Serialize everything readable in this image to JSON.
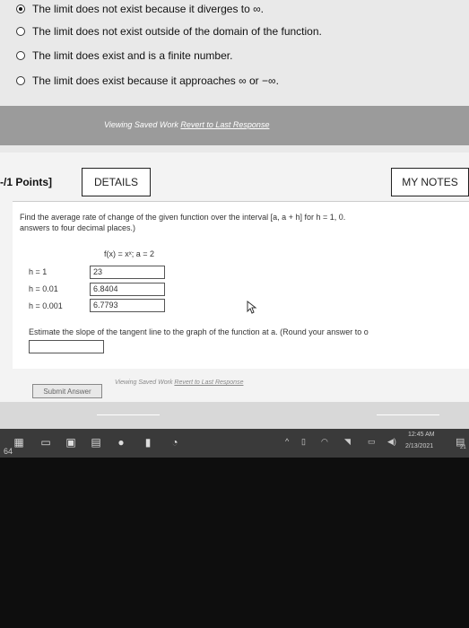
{
  "choices": [
    {
      "label": "The limit does not exist because it diverges to ∞.",
      "selected": true
    },
    {
      "label": "The limit does not exist outside of the domain of the function.",
      "selected": false
    },
    {
      "label": "The limit does exist and is a finite number.",
      "selected": false
    },
    {
      "label": "The limit does exist because it approaches ∞ or −∞.",
      "selected": false
    }
  ],
  "links_top": {
    "viewing": "Viewing Saved Work",
    "revert": "Revert to Last Response"
  },
  "header": {
    "points": "-/1 Points]",
    "details": "DETAILS",
    "my_notes": "MY NOTES"
  },
  "question": {
    "line1": "Find the average rate of change of the given function over the interval [a, a + h] for h = 1, 0.",
    "line2": "answers to four decimal places.)",
    "function": "f(x) = xˣ; a = 2"
  },
  "rows": [
    {
      "h_label": "h = 1",
      "value": "23"
    },
    {
      "h_label": "h = 0.01",
      "value": "6.8404"
    },
    {
      "h_label": "h = 0.001",
      "value": "6.7793"
    }
  ],
  "estimate": {
    "prompt": "Estimate the slope of the tangent line to the graph of the function at a. (Round your answer to o",
    "value": ""
  },
  "submit_label": "Submit Answer",
  "links_bottom": {
    "viewing": "Viewing Saved Work",
    "revert": "Revert to Last Response"
  },
  "taskbar": {
    "badge": "64",
    "time": "12:45 AM",
    "date": "2/13/2021",
    "notification_count": "21"
  },
  "colors": {
    "screen_bg": "#f3f3f3",
    "grey_bar": "#9b9b9b",
    "taskbar": "#3a3a3a"
  }
}
